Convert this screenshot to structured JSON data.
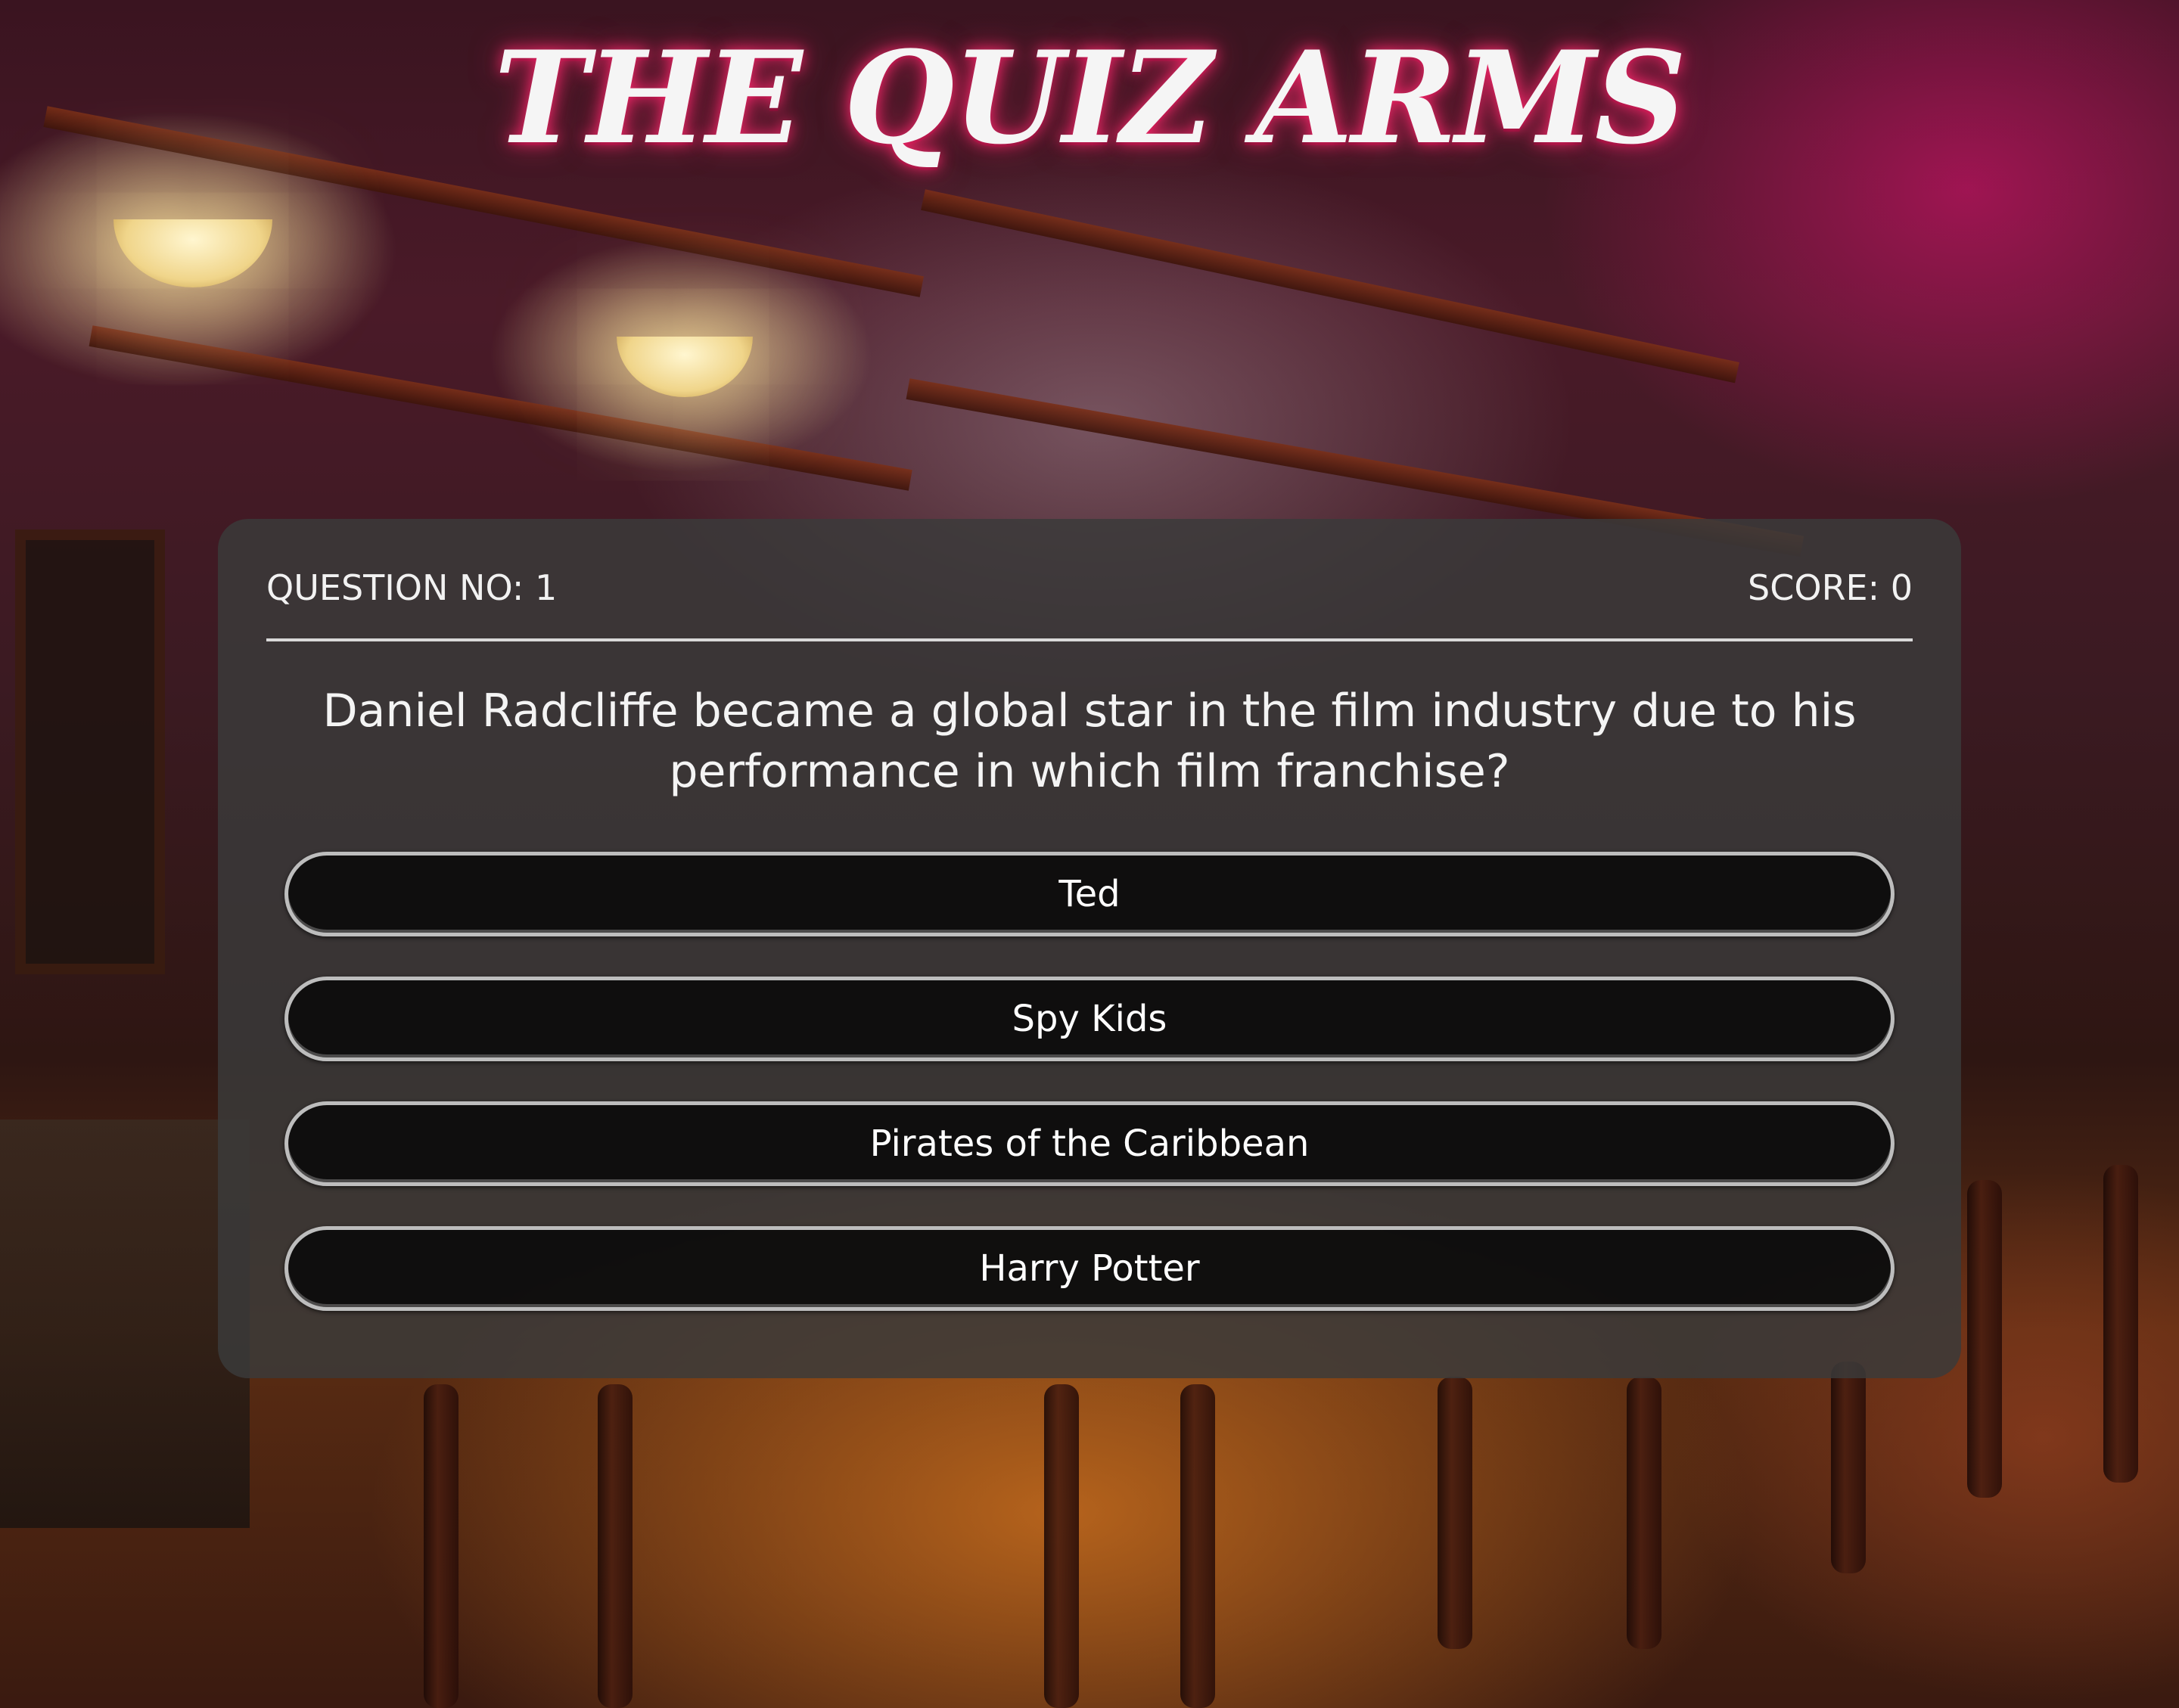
{
  "app": {
    "title": "THE QUIZ ARMS"
  },
  "quiz": {
    "question_number_label": "QUESTION NO: 1",
    "score_label": "SCORE: 0",
    "question_text": "Daniel Radcliffe became a global star in the film industry due to his performance in which film franchise?",
    "answers": [
      "Ted",
      "Spy Kids",
      "Pirates of the Caribbean",
      "Harry Potter"
    ]
  },
  "colors": {
    "panel_bg": "#3a3a3a",
    "answer_bg": "#080808",
    "answer_border": "#bdbdbd",
    "title_glow": "#ff286e"
  }
}
